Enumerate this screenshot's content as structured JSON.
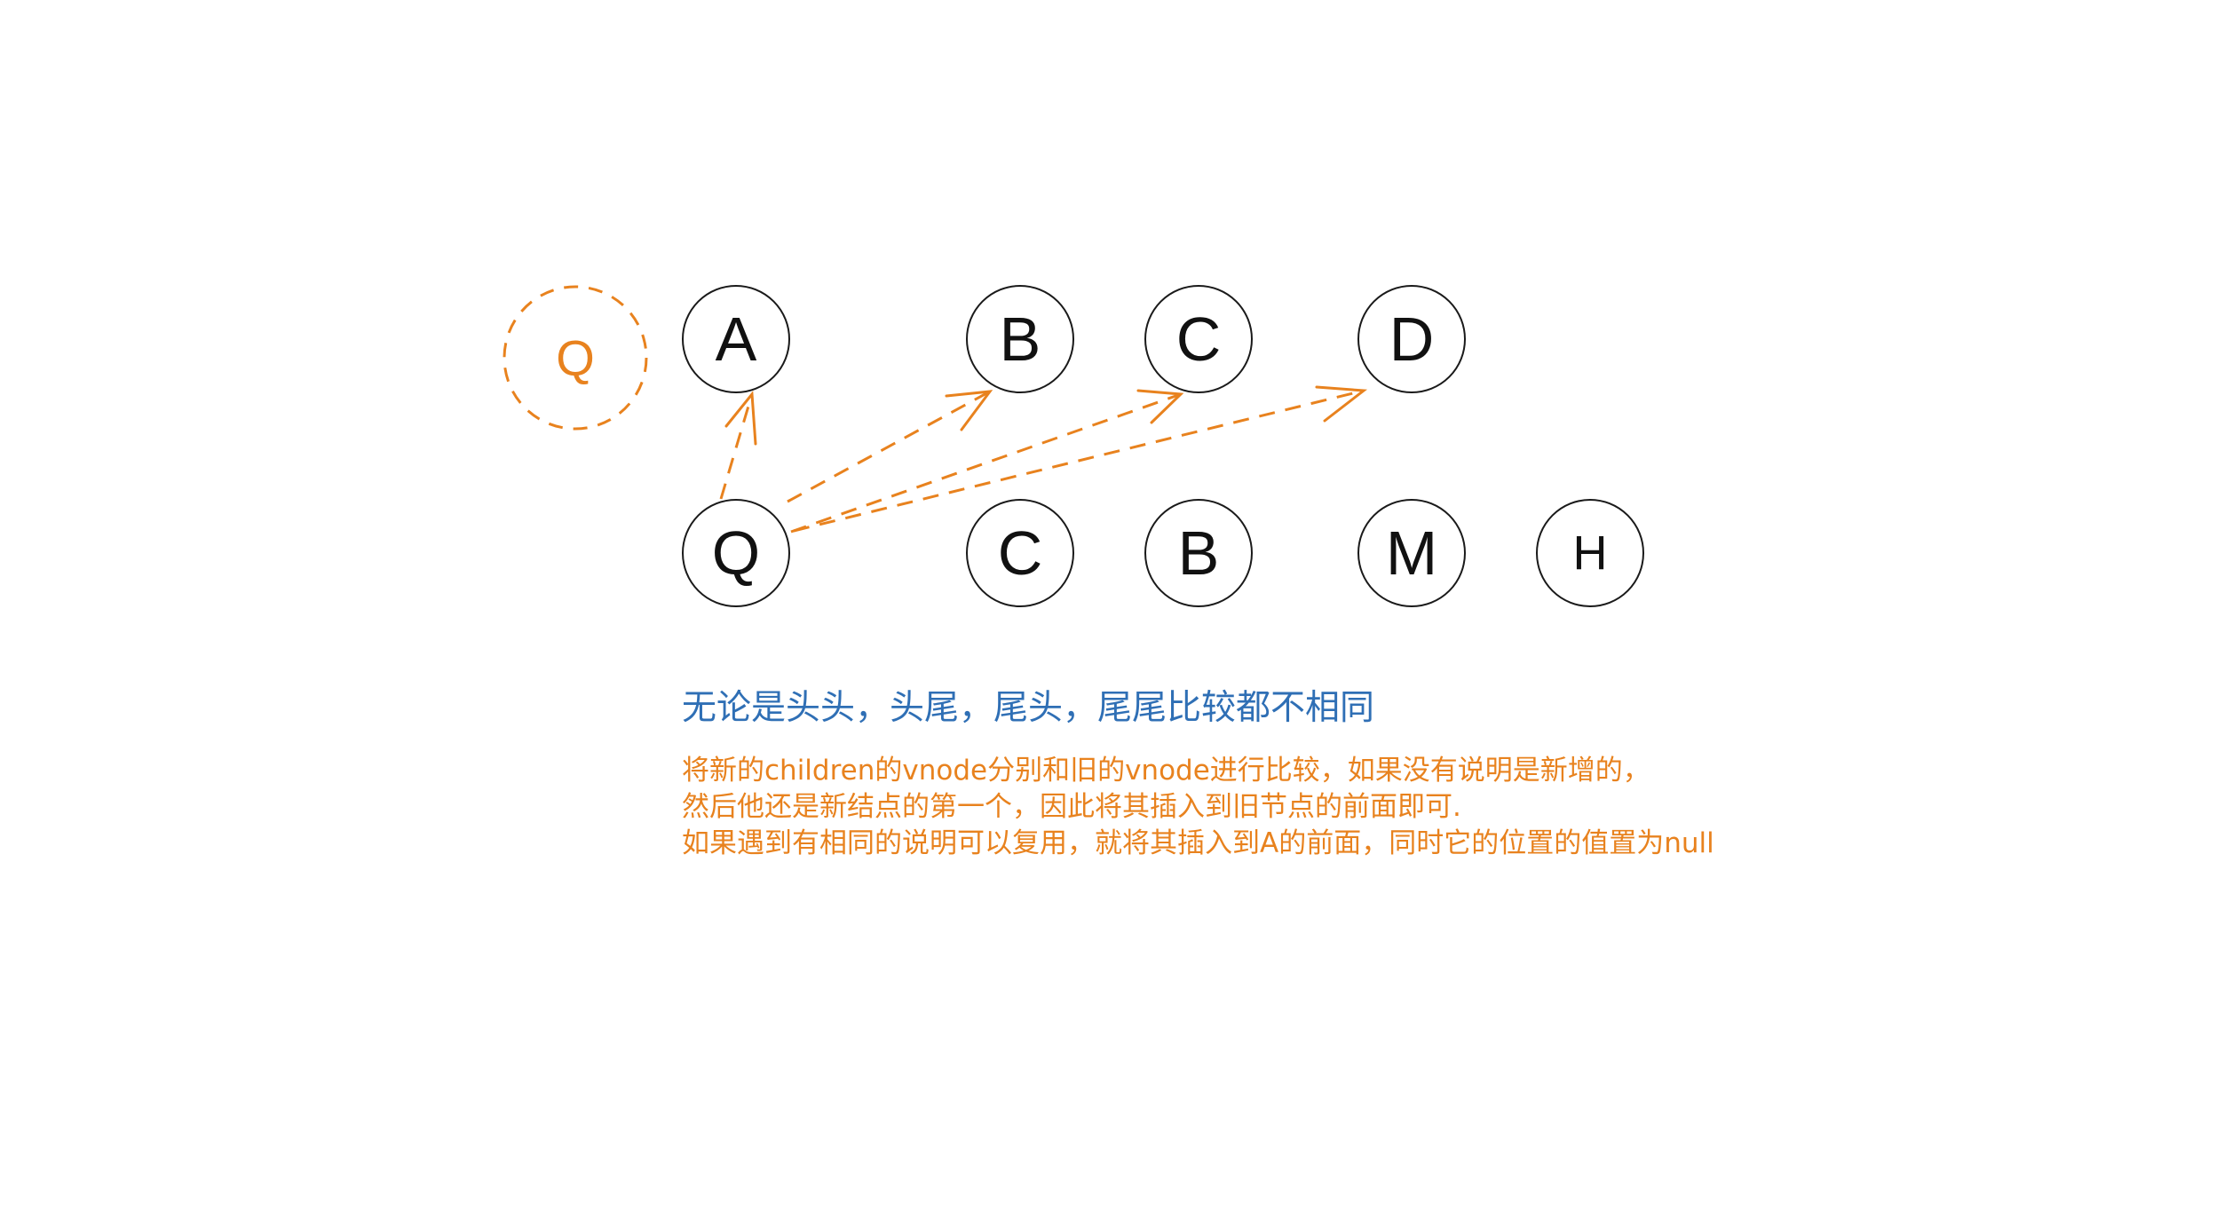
{
  "diagram": {
    "ghost_node": {
      "label": "Q",
      "color": "#e8821e"
    },
    "old_nodes": [
      {
        "id": "A",
        "label": "A"
      },
      {
        "id": "B",
        "label": "B"
      },
      {
        "id": "C",
        "label": "C"
      },
      {
        "id": "D",
        "label": "D"
      }
    ],
    "new_nodes": [
      {
        "id": "Q",
        "label": "Q"
      },
      {
        "id": "C2",
        "label": "C"
      },
      {
        "id": "B2",
        "label": "B"
      },
      {
        "id": "M",
        "label": "M"
      },
      {
        "id": "H",
        "label": "H"
      }
    ],
    "edges": [
      {
        "from": "Q",
        "to": "A"
      },
      {
        "from": "Q",
        "to": "B"
      },
      {
        "from": "Q",
        "to": "C"
      },
      {
        "from": "Q",
        "to": "D"
      }
    ],
    "heading": "无论是头头，头尾，尾头，尾尾比较都不相同",
    "notes": [
      "将新的children的vnode分别和旧的vnode进行比较，如果没有说明是新增的，",
      "然后他还是新结点的第一个，因此将其插入到旧节点的前面即可.",
      "如果遇到有相同的说明可以复用，就将其插入到A的前面，同时它的位置的值置为null"
    ],
    "colors": {
      "accent": "#e8821e",
      "heading": "#2f6fb5",
      "node_stroke": "#1a1a1a"
    }
  }
}
